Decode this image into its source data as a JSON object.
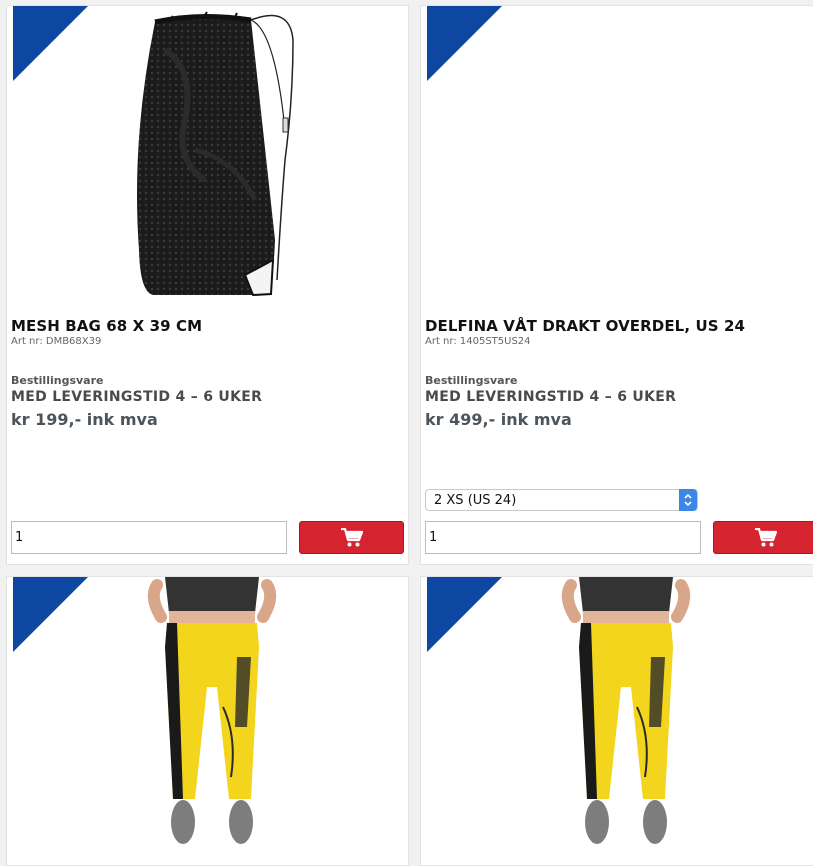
{
  "products": [
    {
      "title": "MESH BAG 68 X 39 CM",
      "art": "Art nr: DMB68X39",
      "availability": "Bestillingsvare",
      "delivery": "MED LEVERINGSTID 4 – 6 UKER",
      "price": "kr 199,- ink mva",
      "quantity": "1",
      "image_icon": "mesh-bag-image"
    },
    {
      "title": "DELFINA VÅT DRAKT OVERDEL, US 24",
      "art": "Art nr: 1405ST5US24",
      "availability": "Bestillingsvare",
      "delivery": "MED LEVERINGSTID 4 – 6 UKER",
      "price": "kr 499,- ink mva",
      "size_selected": "2 XS (US 24)",
      "quantity": "1"
    },
    {
      "image_icon": "yellow-sweatpants-image"
    },
    {
      "image_icon": "yellow-sweatpants-image"
    }
  ],
  "colors": {
    "ribbon": "#0d47a1",
    "cart_button": "#d52330",
    "select_arrow": "#3b87e6"
  },
  "icons": {
    "cart": "cart-icon",
    "ribbon": "corner-ribbon"
  }
}
